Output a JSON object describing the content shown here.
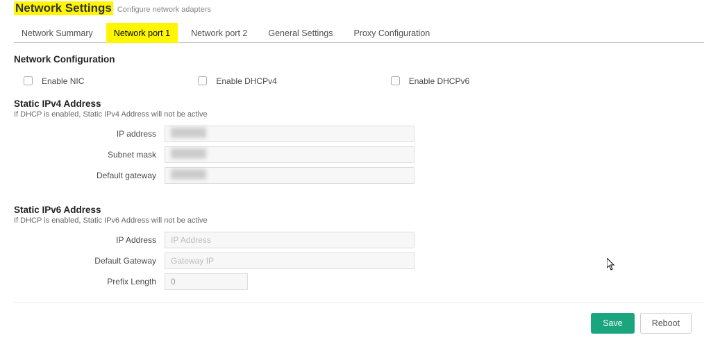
{
  "header": {
    "title": "Network Settings",
    "subtitle": "Configure network adapters"
  },
  "tabs": [
    {
      "label": "Network Summary",
      "active": false
    },
    {
      "label": "Network port 1",
      "active": true
    },
    {
      "label": "Network port 2",
      "active": false
    },
    {
      "label": "General Settings",
      "active": false
    },
    {
      "label": "Proxy Configuration",
      "active": false
    }
  ],
  "network_config": {
    "section_title": "Network Configuration",
    "enable_nic": {
      "label": "Enable NIC",
      "checked": false
    },
    "enable_dhcp4": {
      "label": "Enable DHCPv4",
      "checked": false
    },
    "enable_dhcp6": {
      "label": "Enable DHCPv6",
      "checked": false
    }
  },
  "ipv4": {
    "section_title": "Static IPv4 Address",
    "hint": "If DHCP is enabled, Static IPv4 Address will not be active",
    "ip_label": "IP address",
    "ip_value": "██████",
    "mask_label": "Subnet mask",
    "mask_value": "██████",
    "gateway_label": "Default gateway",
    "gateway_value": "██████"
  },
  "ipv6": {
    "section_title": "Static IPv6 Address",
    "hint": "If DHCP is enabled, Static IPv6 Address will not be active",
    "ip_label": "IP Address",
    "ip_placeholder": "IP Address",
    "gateway_label": "Default Gateway",
    "gateway_placeholder": "Gateway IP",
    "prefix_label": "Prefix Length",
    "prefix_value": "0"
  },
  "footer": {
    "save": "Save",
    "reboot": "Reboot"
  }
}
